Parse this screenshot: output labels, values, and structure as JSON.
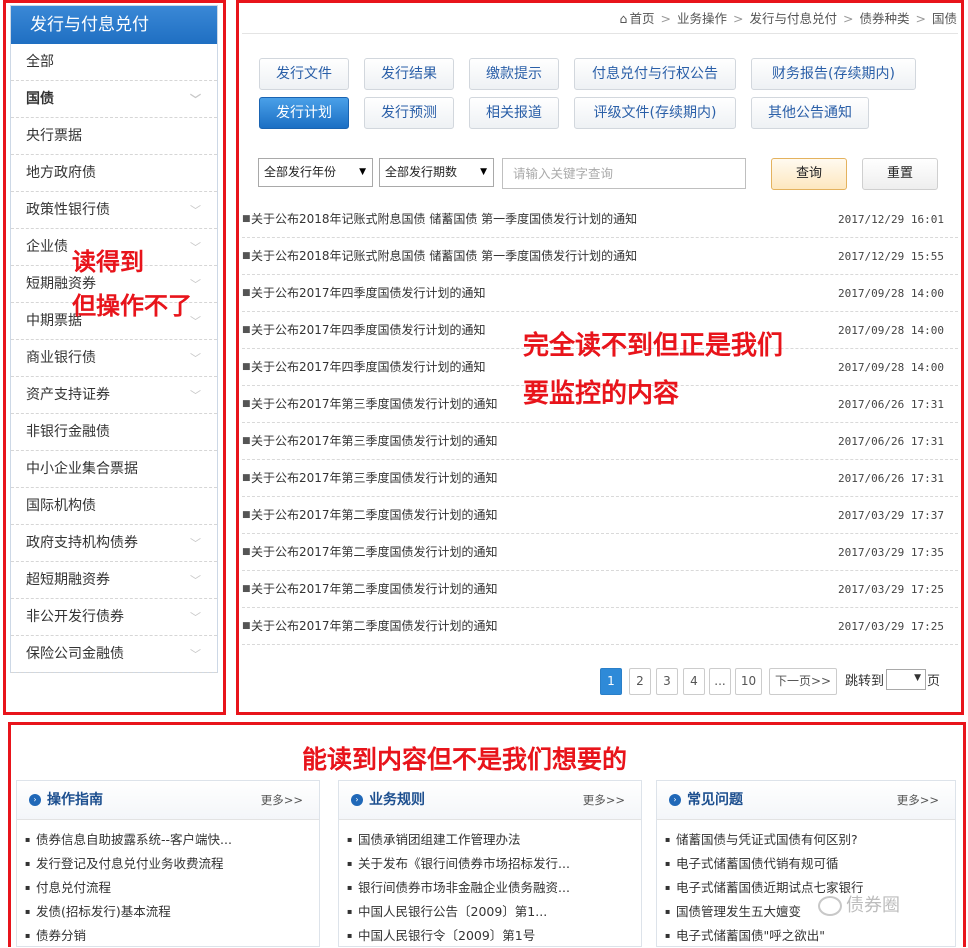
{
  "sidebar": {
    "title": "发行与付息兑付",
    "items": [
      {
        "label": "全部",
        "bold": false,
        "chevron": false
      },
      {
        "label": "国债",
        "bold": true,
        "chevron": true
      },
      {
        "label": "央行票据",
        "bold": false,
        "chevron": false
      },
      {
        "label": "地方政府债",
        "bold": false,
        "chevron": false
      },
      {
        "label": "政策性银行债",
        "bold": false,
        "chevron": true
      },
      {
        "label": "企业债",
        "bold": false,
        "chevron": true
      },
      {
        "label": "短期融资券",
        "bold": false,
        "chevron": true
      },
      {
        "label": "中期票据",
        "bold": false,
        "chevron": true
      },
      {
        "label": "商业银行债",
        "bold": false,
        "chevron": true
      },
      {
        "label": "资产支持证券",
        "bold": false,
        "chevron": true
      },
      {
        "label": "非银行金融债",
        "bold": false,
        "chevron": false
      },
      {
        "label": "中小企业集合票据",
        "bold": false,
        "chevron": false
      },
      {
        "label": "国际机构债",
        "bold": false,
        "chevron": false
      },
      {
        "label": "政府支持机构债券",
        "bold": false,
        "chevron": true
      },
      {
        "label": "超短期融资券",
        "bold": false,
        "chevron": true
      },
      {
        "label": "非公开发行债券",
        "bold": false,
        "chevron": true
      },
      {
        "label": "保险公司金融债",
        "bold": false,
        "chevron": true
      }
    ]
  },
  "breadcrumb": [
    "首页",
    "业务操作",
    "发行与付息兑付",
    "债券种类",
    "国债"
  ],
  "tabs": [
    {
      "label": "发行文件",
      "active": false
    },
    {
      "label": "发行结果",
      "active": false
    },
    {
      "label": "缴款提示",
      "active": false
    },
    {
      "label": "付息兑付与行权公告",
      "active": false
    },
    {
      "label": "财务报告(存续期内)",
      "active": false
    },
    {
      "label": "发行计划",
      "active": true
    },
    {
      "label": "发行预测",
      "active": false
    },
    {
      "label": "相关报道",
      "active": false
    },
    {
      "label": "评级文件(存续期内)",
      "active": false
    },
    {
      "label": "其他公告通知",
      "active": false
    }
  ],
  "filters": {
    "year_select": "全部发行年份",
    "term_select": "全部发行期数",
    "search_placeholder": "请输入关键字查询",
    "query_label": "查询",
    "reset_label": "重置"
  },
  "notices": [
    {
      "title": "关于公布2018年记账式附息国债 储蓄国债 第一季度国债发行计划的通知",
      "date": "2017/12/29 16:01"
    },
    {
      "title": "关于公布2018年记账式附息国债 储蓄国债 第一季度国债发行计划的通知",
      "date": "2017/12/29 15:55"
    },
    {
      "title": "关于公布2017年四季度国债发行计划的通知",
      "date": "2017/09/28 14:00"
    },
    {
      "title": "关于公布2017年四季度国债发行计划的通知",
      "date": "2017/09/28 14:00"
    },
    {
      "title": "关于公布2017年四季度国债发行计划的通知",
      "date": "2017/09/28 14:00"
    },
    {
      "title": "关于公布2017年第三季度国债发行计划的通知",
      "date": "2017/06/26 17:31"
    },
    {
      "title": "关于公布2017年第三季度国债发行计划的通知",
      "date": "2017/06/26 17:31"
    },
    {
      "title": "关于公布2017年第三季度国债发行计划的通知",
      "date": "2017/06/26 17:31"
    },
    {
      "title": "关于公布2017年第二季度国债发行计划的通知",
      "date": "2017/03/29 17:37"
    },
    {
      "title": "关于公布2017年第二季度国债发行计划的通知",
      "date": "2017/03/29 17:35"
    },
    {
      "title": "关于公布2017年第二季度国债发行计划的通知",
      "date": "2017/03/29 17:25"
    },
    {
      "title": "关于公布2017年第二季度国债发行计划的通知",
      "date": "2017/03/29 17:25"
    }
  ],
  "pagination": {
    "pages": [
      "1",
      "2",
      "3",
      "4",
      "...",
      "10"
    ],
    "current": "1",
    "next_label": "下一页>>",
    "jump_label": "跳转到",
    "page_suffix": "页"
  },
  "panels": [
    {
      "title": "操作指南",
      "more": "更多>>",
      "items": [
        "债券信息自助披露系统--客户端快...",
        "发行登记及付息兑付业务收费流程",
        "付息兑付流程",
        "发债(招标发行)基本流程",
        "债券分销"
      ]
    },
    {
      "title": "业务规则",
      "more": "更多>>",
      "items": [
        "国债承销团组建工作管理办法",
        "关于发布《银行间债券市场招标发行...",
        "银行间债券市场非金融企业债务融资...",
        "中国人民银行公告〔2009〕第1...",
        "中国人民银行令〔2009〕第1号"
      ]
    },
    {
      "title": "常见问题",
      "more": "更多>>",
      "items": [
        "储蓄国债与凭证式国债有何区别?",
        "电子式储蓄国债代销有规可循",
        "电子式储蓄国债近期试点七家银行",
        "国债管理发生五大嬗变",
        "电子式储蓄国债\"呼之欲出\""
      ]
    }
  ],
  "annotations": {
    "sidebar": "读得到\n但操作不了",
    "main": "完全读不到但正是我们\n要监控的内容",
    "bottom": "能读到内容但不是我们想要的"
  },
  "watermark": "债券圈",
  "colors": {
    "accent": "#1f6fc2",
    "annotation_red": "#e8141b",
    "active_page": "#2e8ad8"
  }
}
